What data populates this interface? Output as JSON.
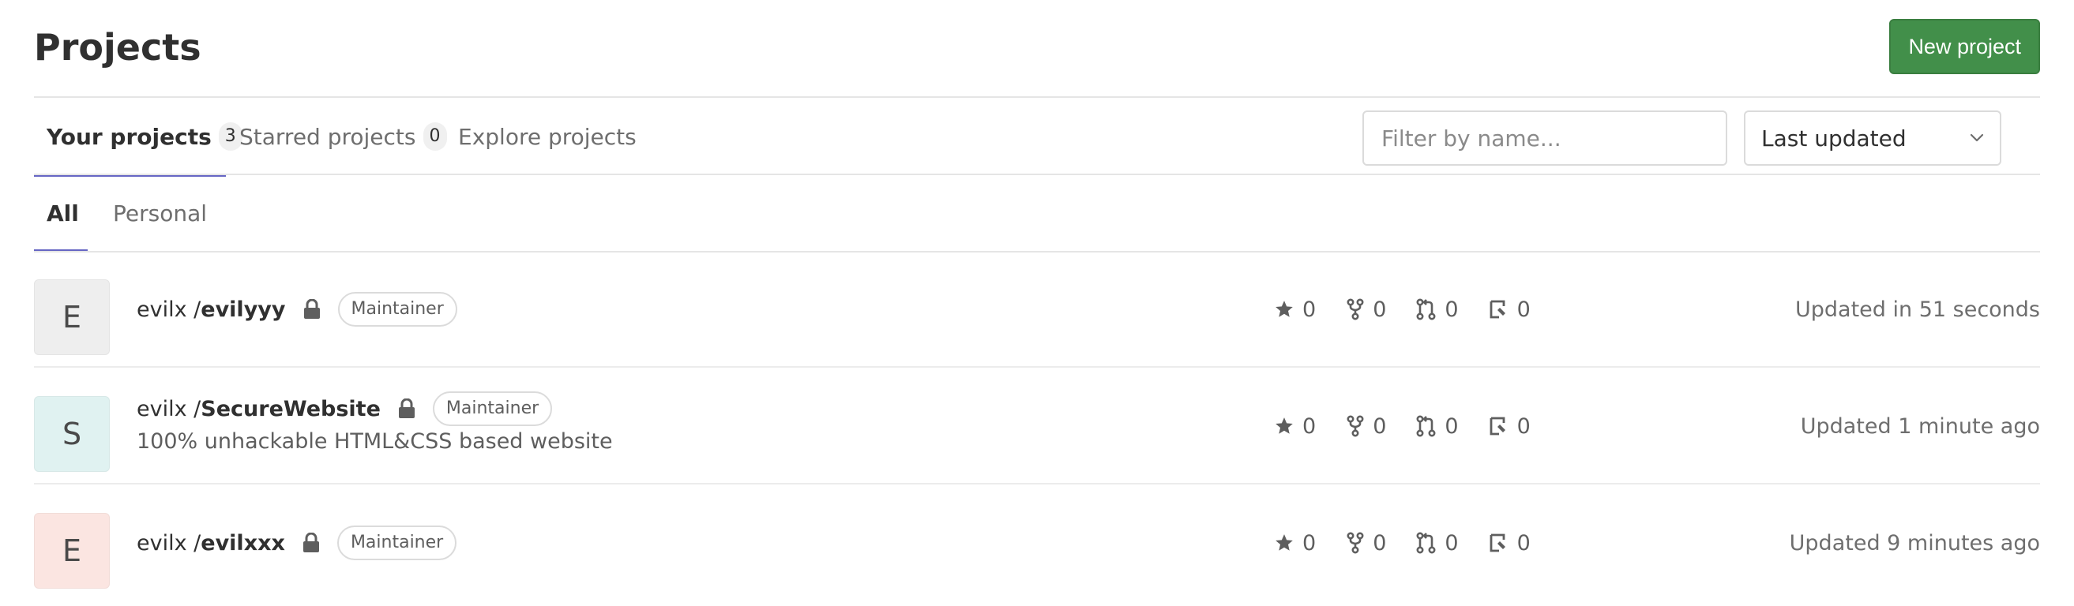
{
  "header": {
    "title": "Projects",
    "new_project_label": "New project"
  },
  "tabs": [
    {
      "label": "Your projects",
      "count": "3",
      "active": true
    },
    {
      "label": "Starred projects",
      "count": "0",
      "active": false
    },
    {
      "label": "Explore projects",
      "active": false
    }
  ],
  "filter": {
    "placeholder": "Filter by name...",
    "value": ""
  },
  "sort": {
    "selected": "Last updated"
  },
  "subtabs": [
    {
      "label": "All",
      "active": true
    },
    {
      "label": "Personal",
      "active": false
    }
  ],
  "projects": [
    {
      "avatar_letter": "E",
      "avatar_color": "#eeeeee",
      "namespace": "evilx / ",
      "name": "evilyyy",
      "visibility_icon": "lock-icon",
      "role": "Maintainer",
      "description": "",
      "stars": "0",
      "forks": "0",
      "merge_requests": "0",
      "issues": "0",
      "updated": "Updated in 51 seconds"
    },
    {
      "avatar_letter": "S",
      "avatar_color": "#e0f2f1",
      "namespace": "evilx / ",
      "name": "SecureWebsite",
      "visibility_icon": "lock-icon",
      "role": "Maintainer",
      "description": "100% unhackable HTML&CSS based website",
      "stars": "0",
      "forks": "0",
      "merge_requests": "0",
      "issues": "0",
      "updated": "Updated 1 minute ago"
    },
    {
      "avatar_letter": "E",
      "avatar_color": "#fbe5e1",
      "namespace": "evilx / ",
      "name": "evilxxx",
      "visibility_icon": "lock-icon",
      "role": "Maintainer",
      "description": "",
      "stars": "0",
      "forks": "0",
      "merge_requests": "0",
      "issues": "0",
      "updated": "Updated 9 minutes ago"
    }
  ],
  "icons": {
    "star": "star-icon",
    "fork": "fork-icon",
    "merge_request": "merge-request-icon",
    "issue": "issues-icon",
    "chevron": "chevron-down-icon"
  },
  "colors": {
    "primary_button": "#428f4a",
    "active_tab_underline": "#6666c4"
  }
}
